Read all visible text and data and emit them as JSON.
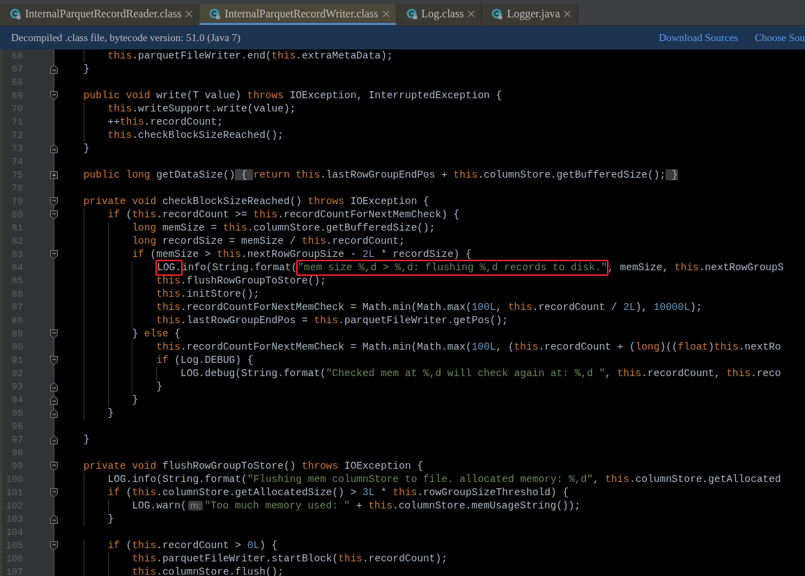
{
  "tabs": [
    {
      "label": "InternalParquetRecordReader.class",
      "selected": false
    },
    {
      "label": "InternalParquetRecordWriter.class",
      "selected": true
    },
    {
      "label": "Log.class",
      "selected": false
    },
    {
      "label": "Logger.java",
      "selected": false
    }
  ],
  "notification": {
    "message": "Decompiled .class file, bytecode version: 51.0 (Java 7)",
    "links": [
      "Download Sources",
      "Choose Sou"
    ]
  },
  "editor": {
    "lines": [
      {
        "number": "66",
        "tokens": [
          {
            "kind": "keyword",
            "text": "        this"
          },
          {
            "kind": "plain",
            "text": ".parquetFileWriter.end("
          },
          {
            "kind": "keyword",
            "text": "this"
          },
          {
            "kind": "plain",
            "text": ".extraMetaData);"
          }
        ]
      },
      {
        "number": "67",
        "fold_marker": {
          "kind": "end"
        },
        "tokens": [
          {
            "kind": "plain",
            "text": "    }"
          }
        ]
      },
      {
        "number": "68"
      },
      {
        "number": "69",
        "fold_marker": {
          "kind": "start"
        },
        "tokens": [
          {
            "kind": "keyword",
            "text": "    public void"
          },
          {
            "kind": "plain",
            "text": " write(T value) "
          },
          {
            "kind": "keyword",
            "text": "throws"
          },
          {
            "kind": "plain",
            "text": " IOException, InterruptedException {"
          }
        ]
      },
      {
        "number": "70",
        "tokens": [
          {
            "kind": "keyword",
            "text": "        this"
          },
          {
            "kind": "plain",
            "text": ".writeSupport.write(value);"
          }
        ]
      },
      {
        "number": "71",
        "tokens": [
          {
            "kind": "plain",
            "text": "        ++"
          },
          {
            "kind": "keyword",
            "text": "this"
          },
          {
            "kind": "plain",
            "text": ".recordCount;"
          }
        ]
      },
      {
        "number": "72",
        "tokens": [
          {
            "kind": "keyword",
            "text": "        this"
          },
          {
            "kind": "plain",
            "text": ".checkBlockSizeReached();"
          }
        ]
      },
      {
        "number": "73",
        "fold_marker": {
          "kind": "end"
        },
        "tokens": [
          {
            "kind": "plain",
            "text": "    }"
          }
        ]
      },
      {
        "number": "74"
      },
      {
        "number": "75",
        "fold_marker": {
          "kind": "collapsed"
        },
        "tokens": [
          {
            "kind": "keyword",
            "text": "    public long"
          },
          {
            "kind": "plain",
            "text": " getDataSize()"
          },
          {
            "kind": "fold",
            "text": " { "
          },
          {
            "kind": "keyword",
            "text": "return this"
          },
          {
            "kind": "plain",
            "text": ".lastRowGroupEndPos + "
          },
          {
            "kind": "keyword",
            "text": "this"
          },
          {
            "kind": "plain",
            "text": ".columnStore.getBufferedSize();"
          },
          {
            "kind": "fold",
            "text": " }"
          }
        ]
      },
      {
        "number": "78"
      },
      {
        "number": "79",
        "fold_marker": {
          "kind": "start"
        },
        "tokens": [
          {
            "kind": "keyword",
            "text": "    private void"
          },
          {
            "kind": "plain",
            "text": " checkBlockSizeReached() "
          },
          {
            "kind": "keyword",
            "text": "throws"
          },
          {
            "kind": "plain",
            "text": " IOException {"
          }
        ]
      },
      {
        "number": "80",
        "fold_marker": {
          "kind": "start"
        },
        "tokens": [
          {
            "kind": "keyword",
            "text": "        if"
          },
          {
            "kind": "plain",
            "text": " ("
          },
          {
            "kind": "keyword",
            "text": "this"
          },
          {
            "kind": "plain",
            "text": ".recordCount >= "
          },
          {
            "kind": "keyword",
            "text": "this"
          },
          {
            "kind": "plain",
            "text": ".recordCountForNextMemCheck) {"
          }
        ]
      },
      {
        "number": "81",
        "tokens": [
          {
            "kind": "keyword",
            "text": "            long"
          },
          {
            "kind": "plain",
            "text": " memSize = "
          },
          {
            "kind": "keyword",
            "text": "this"
          },
          {
            "kind": "plain",
            "text": ".columnStore.getBufferedSize();"
          }
        ]
      },
      {
        "number": "82",
        "tokens": [
          {
            "kind": "keyword",
            "text": "            long"
          },
          {
            "kind": "plain",
            "text": " recordSize = memSize / "
          },
          {
            "kind": "keyword",
            "text": "this"
          },
          {
            "kind": "plain",
            "text": ".recordCount;"
          }
        ]
      },
      {
        "number": "83",
        "fold_marker": {
          "kind": "start"
        },
        "tokens": [
          {
            "kind": "keyword",
            "text": "            if"
          },
          {
            "kind": "plain",
            "text": " (memSize > "
          },
          {
            "kind": "keyword",
            "text": "this"
          },
          {
            "kind": "plain",
            "text": ".nextRowGroupSize - "
          },
          {
            "kind": "number",
            "text": "2L"
          },
          {
            "kind": "plain",
            "text": " * recordSize) {"
          }
        ]
      },
      {
        "number": "84",
        "tokens": [
          {
            "kind": "plain",
            "text": "                LOG.",
            "boxed": true
          },
          {
            "kind": "plain",
            "text": "info(String.format("
          },
          {
            "kind": "string",
            "text": "\"mem size %,d > %,d: flushing %,d records to disk.\"",
            "boxed": true
          },
          {
            "kind": "plain",
            "text": ", memSize, "
          },
          {
            "kind": "keyword",
            "text": "this"
          },
          {
            "kind": "plain",
            "text": ".nextRowGroupS"
          }
        ]
      },
      {
        "number": "85",
        "tokens": [
          {
            "kind": "keyword",
            "text": "                this"
          },
          {
            "kind": "plain",
            "text": ".flushRowGroupToStore();"
          }
        ]
      },
      {
        "number": "86",
        "tokens": [
          {
            "kind": "keyword",
            "text": "                this"
          },
          {
            "kind": "plain",
            "text": ".initStore();"
          }
        ]
      },
      {
        "number": "87",
        "tokens": [
          {
            "kind": "keyword",
            "text": "                this"
          },
          {
            "kind": "plain",
            "text": ".recordCountForNextMemCheck = Math.min(Math.max("
          },
          {
            "kind": "number",
            "text": "100L"
          },
          {
            "kind": "plain",
            "text": ", "
          },
          {
            "kind": "keyword",
            "text": "this"
          },
          {
            "kind": "plain",
            "text": ".recordCount / "
          },
          {
            "kind": "number",
            "text": "2L"
          },
          {
            "kind": "plain",
            "text": "), "
          },
          {
            "kind": "number",
            "text": "10000L"
          },
          {
            "kind": "plain",
            "text": ");"
          }
        ]
      },
      {
        "number": "88",
        "tokens": [
          {
            "kind": "keyword",
            "text": "                this"
          },
          {
            "kind": "plain",
            "text": ".lastRowGroupEndPos = "
          },
          {
            "kind": "keyword",
            "text": "this"
          },
          {
            "kind": "plain",
            "text": ".parquetFileWriter.getPos();"
          }
        ]
      },
      {
        "number": "89",
        "fold_marker": {
          "kind": "start"
        },
        "tokens": [
          {
            "kind": "plain",
            "text": "            } "
          },
          {
            "kind": "keyword",
            "text": "else"
          },
          {
            "kind": "plain",
            "text": " {"
          }
        ]
      },
      {
        "number": "90",
        "tokens": [
          {
            "kind": "keyword",
            "text": "                this"
          },
          {
            "kind": "plain",
            "text": ".recordCountForNextMemCheck = Math.min(Math.max("
          },
          {
            "kind": "number",
            "text": "100L"
          },
          {
            "kind": "plain",
            "text": ", ("
          },
          {
            "kind": "keyword",
            "text": "this"
          },
          {
            "kind": "plain",
            "text": ".recordCount + ("
          },
          {
            "kind": "keyword",
            "text": "long"
          },
          {
            "kind": "plain",
            "text": ")(("
          },
          {
            "kind": "keyword",
            "text": "float"
          },
          {
            "kind": "plain",
            "text": ")"
          },
          {
            "kind": "keyword",
            "text": "this"
          },
          {
            "kind": "plain",
            "text": ".nextRo"
          }
        ]
      },
      {
        "number": "91",
        "fold_marker": {
          "kind": "start"
        },
        "tokens": [
          {
            "kind": "keyword",
            "text": "                if"
          },
          {
            "kind": "plain",
            "text": " (Log.DEBUG) {"
          }
        ]
      },
      {
        "number": "92",
        "tokens": [
          {
            "kind": "plain",
            "text": "                    LOG.debug(String.format("
          },
          {
            "kind": "string",
            "text": "\"Checked mem at %,d will check again at: %,d \""
          },
          {
            "kind": "plain",
            "text": ", "
          },
          {
            "kind": "keyword",
            "text": "this"
          },
          {
            "kind": "plain",
            "text": ".recordCount, "
          },
          {
            "kind": "keyword",
            "text": "this"
          },
          {
            "kind": "plain",
            "text": ".reco"
          }
        ]
      },
      {
        "number": "93",
        "fold_marker": {
          "kind": "end"
        },
        "tokens": [
          {
            "kind": "plain",
            "text": "                }"
          }
        ]
      },
      {
        "number": "94",
        "fold_marker": {
          "kind": "end"
        },
        "tokens": [
          {
            "kind": "plain",
            "text": "            }"
          }
        ]
      },
      {
        "number": "95",
        "fold_marker": {
          "kind": "end"
        },
        "tokens": [
          {
            "kind": "plain",
            "text": "        }"
          }
        ]
      },
      {
        "number": "96"
      },
      {
        "number": "97",
        "fold_marker": {
          "kind": "end"
        },
        "tokens": [
          {
            "kind": "plain",
            "text": "    }"
          }
        ]
      },
      {
        "number": "98"
      },
      {
        "number": "99",
        "fold_marker": {
          "kind": "start"
        },
        "tokens": [
          {
            "kind": "keyword",
            "text": "    private void"
          },
          {
            "kind": "plain",
            "text": " flushRowGroupToStore() "
          },
          {
            "kind": "keyword",
            "text": "throws"
          },
          {
            "kind": "plain",
            "text": " IOException {"
          }
        ]
      },
      {
        "number": "100",
        "tokens": [
          {
            "kind": "plain",
            "text": "        LOG.info(String.format("
          },
          {
            "kind": "string",
            "text": "\"Flushing mem columnStore to file. allocated memory: %,d\""
          },
          {
            "kind": "plain",
            "text": ", "
          },
          {
            "kind": "keyword",
            "text": "this"
          },
          {
            "kind": "plain",
            "text": ".columnStore.getAllocated"
          }
        ]
      },
      {
        "number": "101",
        "fold_marker": {
          "kind": "start"
        },
        "tokens": [
          {
            "kind": "keyword",
            "text": "        if"
          },
          {
            "kind": "plain",
            "text": " ("
          },
          {
            "kind": "keyword",
            "text": "this"
          },
          {
            "kind": "plain",
            "text": ".columnStore.getAllocatedSize() > "
          },
          {
            "kind": "number",
            "text": "3L"
          },
          {
            "kind": "plain",
            "text": " * "
          },
          {
            "kind": "keyword",
            "text": "this"
          },
          {
            "kind": "plain",
            "text": ".rowGroupSizeThreshold) {"
          }
        ]
      },
      {
        "number": "102",
        "tokens": [
          {
            "kind": "plain",
            "text": "            LOG.warn("
          },
          {
            "kind": "hint",
            "text": "m:"
          },
          {
            "kind": "string",
            "text": "\"Too much memory used: \""
          },
          {
            "kind": "plain",
            "text": " + "
          },
          {
            "kind": "keyword",
            "text": "this"
          },
          {
            "kind": "plain",
            "text": ".columnStore.memUsageString());"
          }
        ]
      },
      {
        "number": "103",
        "fold_marker": {
          "kind": "end"
        },
        "tokens": [
          {
            "kind": "plain",
            "text": "        }"
          }
        ]
      },
      {
        "number": "104"
      },
      {
        "number": "105",
        "fold_marker": {
          "kind": "start"
        },
        "tokens": [
          {
            "kind": "keyword",
            "text": "        if"
          },
          {
            "kind": "plain",
            "text": " ("
          },
          {
            "kind": "keyword",
            "text": "this"
          },
          {
            "kind": "plain",
            "text": ".recordCount > "
          },
          {
            "kind": "number",
            "text": "0L"
          },
          {
            "kind": "plain",
            "text": ") {"
          }
        ]
      },
      {
        "number": "106",
        "tokens": [
          {
            "kind": "keyword",
            "text": "            this"
          },
          {
            "kind": "plain",
            "text": ".parquetFileWriter.startBlock("
          },
          {
            "kind": "keyword",
            "text": "this"
          },
          {
            "kind": "plain",
            "text": ".recordCount);"
          }
        ]
      },
      {
        "number": "107",
        "tokens": [
          {
            "kind": "keyword",
            "text": "            this"
          },
          {
            "kind": "plain",
            "text": ".columnStore.flush();"
          }
        ]
      }
    ]
  }
}
